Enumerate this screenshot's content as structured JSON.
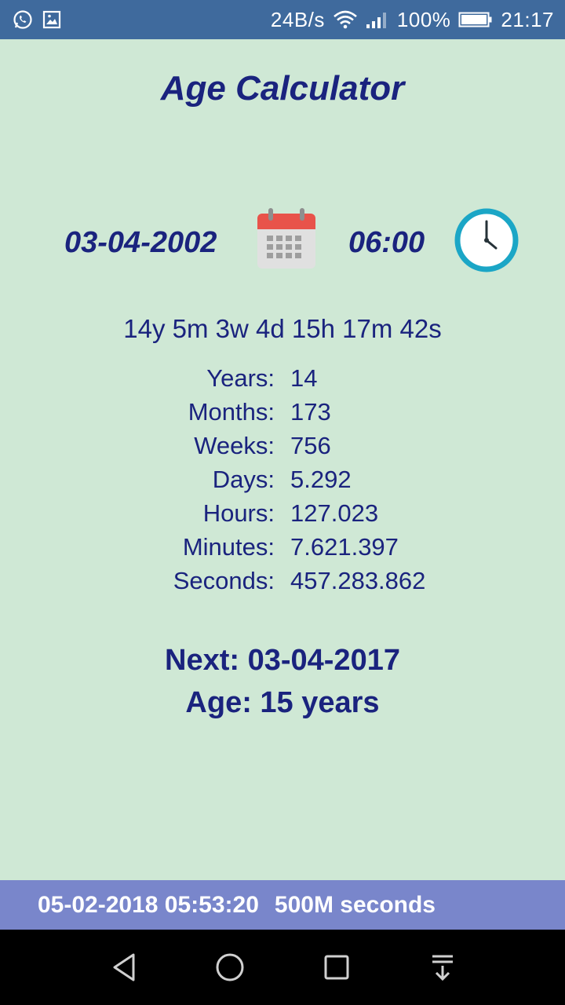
{
  "status_bar": {
    "speed": "24B/s",
    "battery": "100%",
    "time": "21:17",
    "icons": [
      "whatsapp-icon",
      "gallery-icon",
      "wifi-icon",
      "signal-icon",
      "battery-icon"
    ]
  },
  "app": {
    "title": "Age Calculator"
  },
  "picker": {
    "date": "03-04-2002",
    "time": "06:00",
    "calendar_icon": "calendar-icon",
    "clock_icon": "clock-icon"
  },
  "summary": "14y 5m 3w 4d 15h 17m 42s",
  "stats": [
    {
      "label": "Years:",
      "value": "14"
    },
    {
      "label": "Months:",
      "value": "173"
    },
    {
      "label": "Weeks:",
      "value": "756"
    },
    {
      "label": "Days:",
      "value": "5.292"
    },
    {
      "label": "Hours:",
      "value": "127.023"
    },
    {
      "label": "Minutes:",
      "value": "7.621.397"
    },
    {
      "label": "Seconds:",
      "value": "457.283.862"
    }
  ],
  "next": {
    "next_text": "Next: 03-04-2017",
    "age_text": "Age: 15 years"
  },
  "milestone": {
    "datetime": "05-02-2018 05:53:20",
    "label": "500M seconds"
  },
  "colors": {
    "background": "#cfe8d5",
    "text": "#1a237e",
    "status_bar": "#3f6a9d",
    "milestone_bar": "#7986cb",
    "clock_ring": "#1ba6c6",
    "calendar_red": "#e8534a"
  }
}
